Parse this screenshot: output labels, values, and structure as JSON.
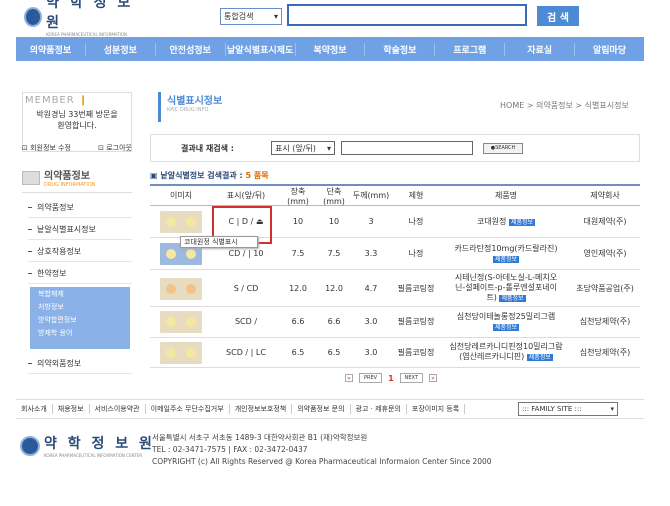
{
  "header": {
    "logo_name": "약 학 정 보 원",
    "logo_sub": "KOREA PHARMACEUTICAL INFORMATION CENTER",
    "search_scope": "통합검색",
    "search_button": "검 색"
  },
  "nav": [
    "의약품정보",
    "성분정보",
    "안전성정보",
    "낱알식별표시제도",
    "복약정보",
    "학술정보",
    "프로그램",
    "자료실",
    "알림마당"
  ],
  "member": {
    "title": "MEMBER",
    "message_line1": "박원경님 33번째 방문을",
    "message_line2": "환영합니다.",
    "edit": "회원정보 수정",
    "logout": "로그아웃"
  },
  "category": {
    "title": "의약품정보",
    "subtitle": "DRUG INFORMATION"
  },
  "sidebar": {
    "items": [
      "의약품정보",
      "낱알식별표시정보",
      "상호작용정보",
      "한약정보",
      "의약외품정보"
    ],
    "sub_items": [
      "복합제제",
      "처방정보",
      "방약합편정보",
      "방제학 용어"
    ]
  },
  "page": {
    "title": "식별표시정보",
    "subtitle": "KPIC DRUG INFO",
    "breadcrumb": "HOME > 의약품정보 > 식별표시정보"
  },
  "refine": {
    "label": "결과내 재검색 :",
    "select": "표시 (앞/뒤)",
    "button": "SEARCH"
  },
  "result": {
    "label": "낱알식별정보 검색결과 :",
    "count": "5 품목"
  },
  "table": {
    "headers": [
      "이미지",
      "표시(앞/뒤)",
      "장축(mm)",
      "단축(mm)",
      "두께(mm)",
      "제형",
      "제품명",
      "제약회사"
    ],
    "rows": [
      {
        "mark_front": "C",
        "mark_back": "D /",
        "long": "10",
        "short": "10",
        "thick": "3",
        "form": "나정",
        "name": "코대원정",
        "name2": "",
        "company": "대원제약(주)"
      },
      {
        "mark_front": "CD /",
        "mark_back": "10",
        "long": "7.5",
        "short": "7.5",
        "thick": "3.3",
        "form": "나정",
        "name": "카드라탄정10mg(카드랄라진)",
        "name2": "",
        "company": "영인제약(주)"
      },
      {
        "mark_front": "S /",
        "mark_back": "CD",
        "long": "12.0",
        "short": "12.0",
        "thick": "4.7",
        "form": "필름코팅정",
        "name": "시테닌정(S-아데노실-L-메치오",
        "name2": "닌-설페이트-p-톨루엔설포네이",
        "name3": "트)",
        "company": "초당약품공업(주)"
      },
      {
        "mark_front": "SCD /",
        "mark_back": "",
        "long": "6.6",
        "short": "6.6",
        "thick": "3.0",
        "form": "필름코팅정",
        "name": "심천당이테놀롱정25밀리그램",
        "name2": "",
        "company": "심천당제약(주)"
      },
      {
        "mark_front": "SCD /",
        "mark_back": "LC",
        "long": "6.5",
        "short": "6.5",
        "thick": "3.0",
        "form": "필름코팅정",
        "name": "심천당레르카니디핀정10밀리그람",
        "name2": "(염산레르카니디핀)",
        "company": "심천당제약(주)"
      }
    ],
    "badge": "제품정보",
    "tooltip": "코대원정 식별표시"
  },
  "pager": {
    "prev": "PREV",
    "page": "1",
    "next": "NEXT"
  },
  "footer": {
    "links": [
      "회사소개",
      "채용정보",
      "서비스이용약관",
      "이메일주소 무단수집거부",
      "개인정보보호정책",
      "의약품정보 문의",
      "광고 · 제휴문의",
      "포장이미지 등록"
    ],
    "family_site": "::: FAMILY SITE :::",
    "address": "서울특별시 서초구 서초동 1489-3 대한약사회관 B1 (재)약학정보원",
    "tel": "TEL : 02-3471-7575  |  FAX : 02-3472-0437",
    "copyright": "COPYRIGHT (c) All Rights Reserved @ Korea Pharmaceutical Informaion Center Since 2000"
  },
  "colors": {
    "nav": "#6fa1e4",
    "accent": "#4d8ad6",
    "highlight": "#d23030"
  }
}
